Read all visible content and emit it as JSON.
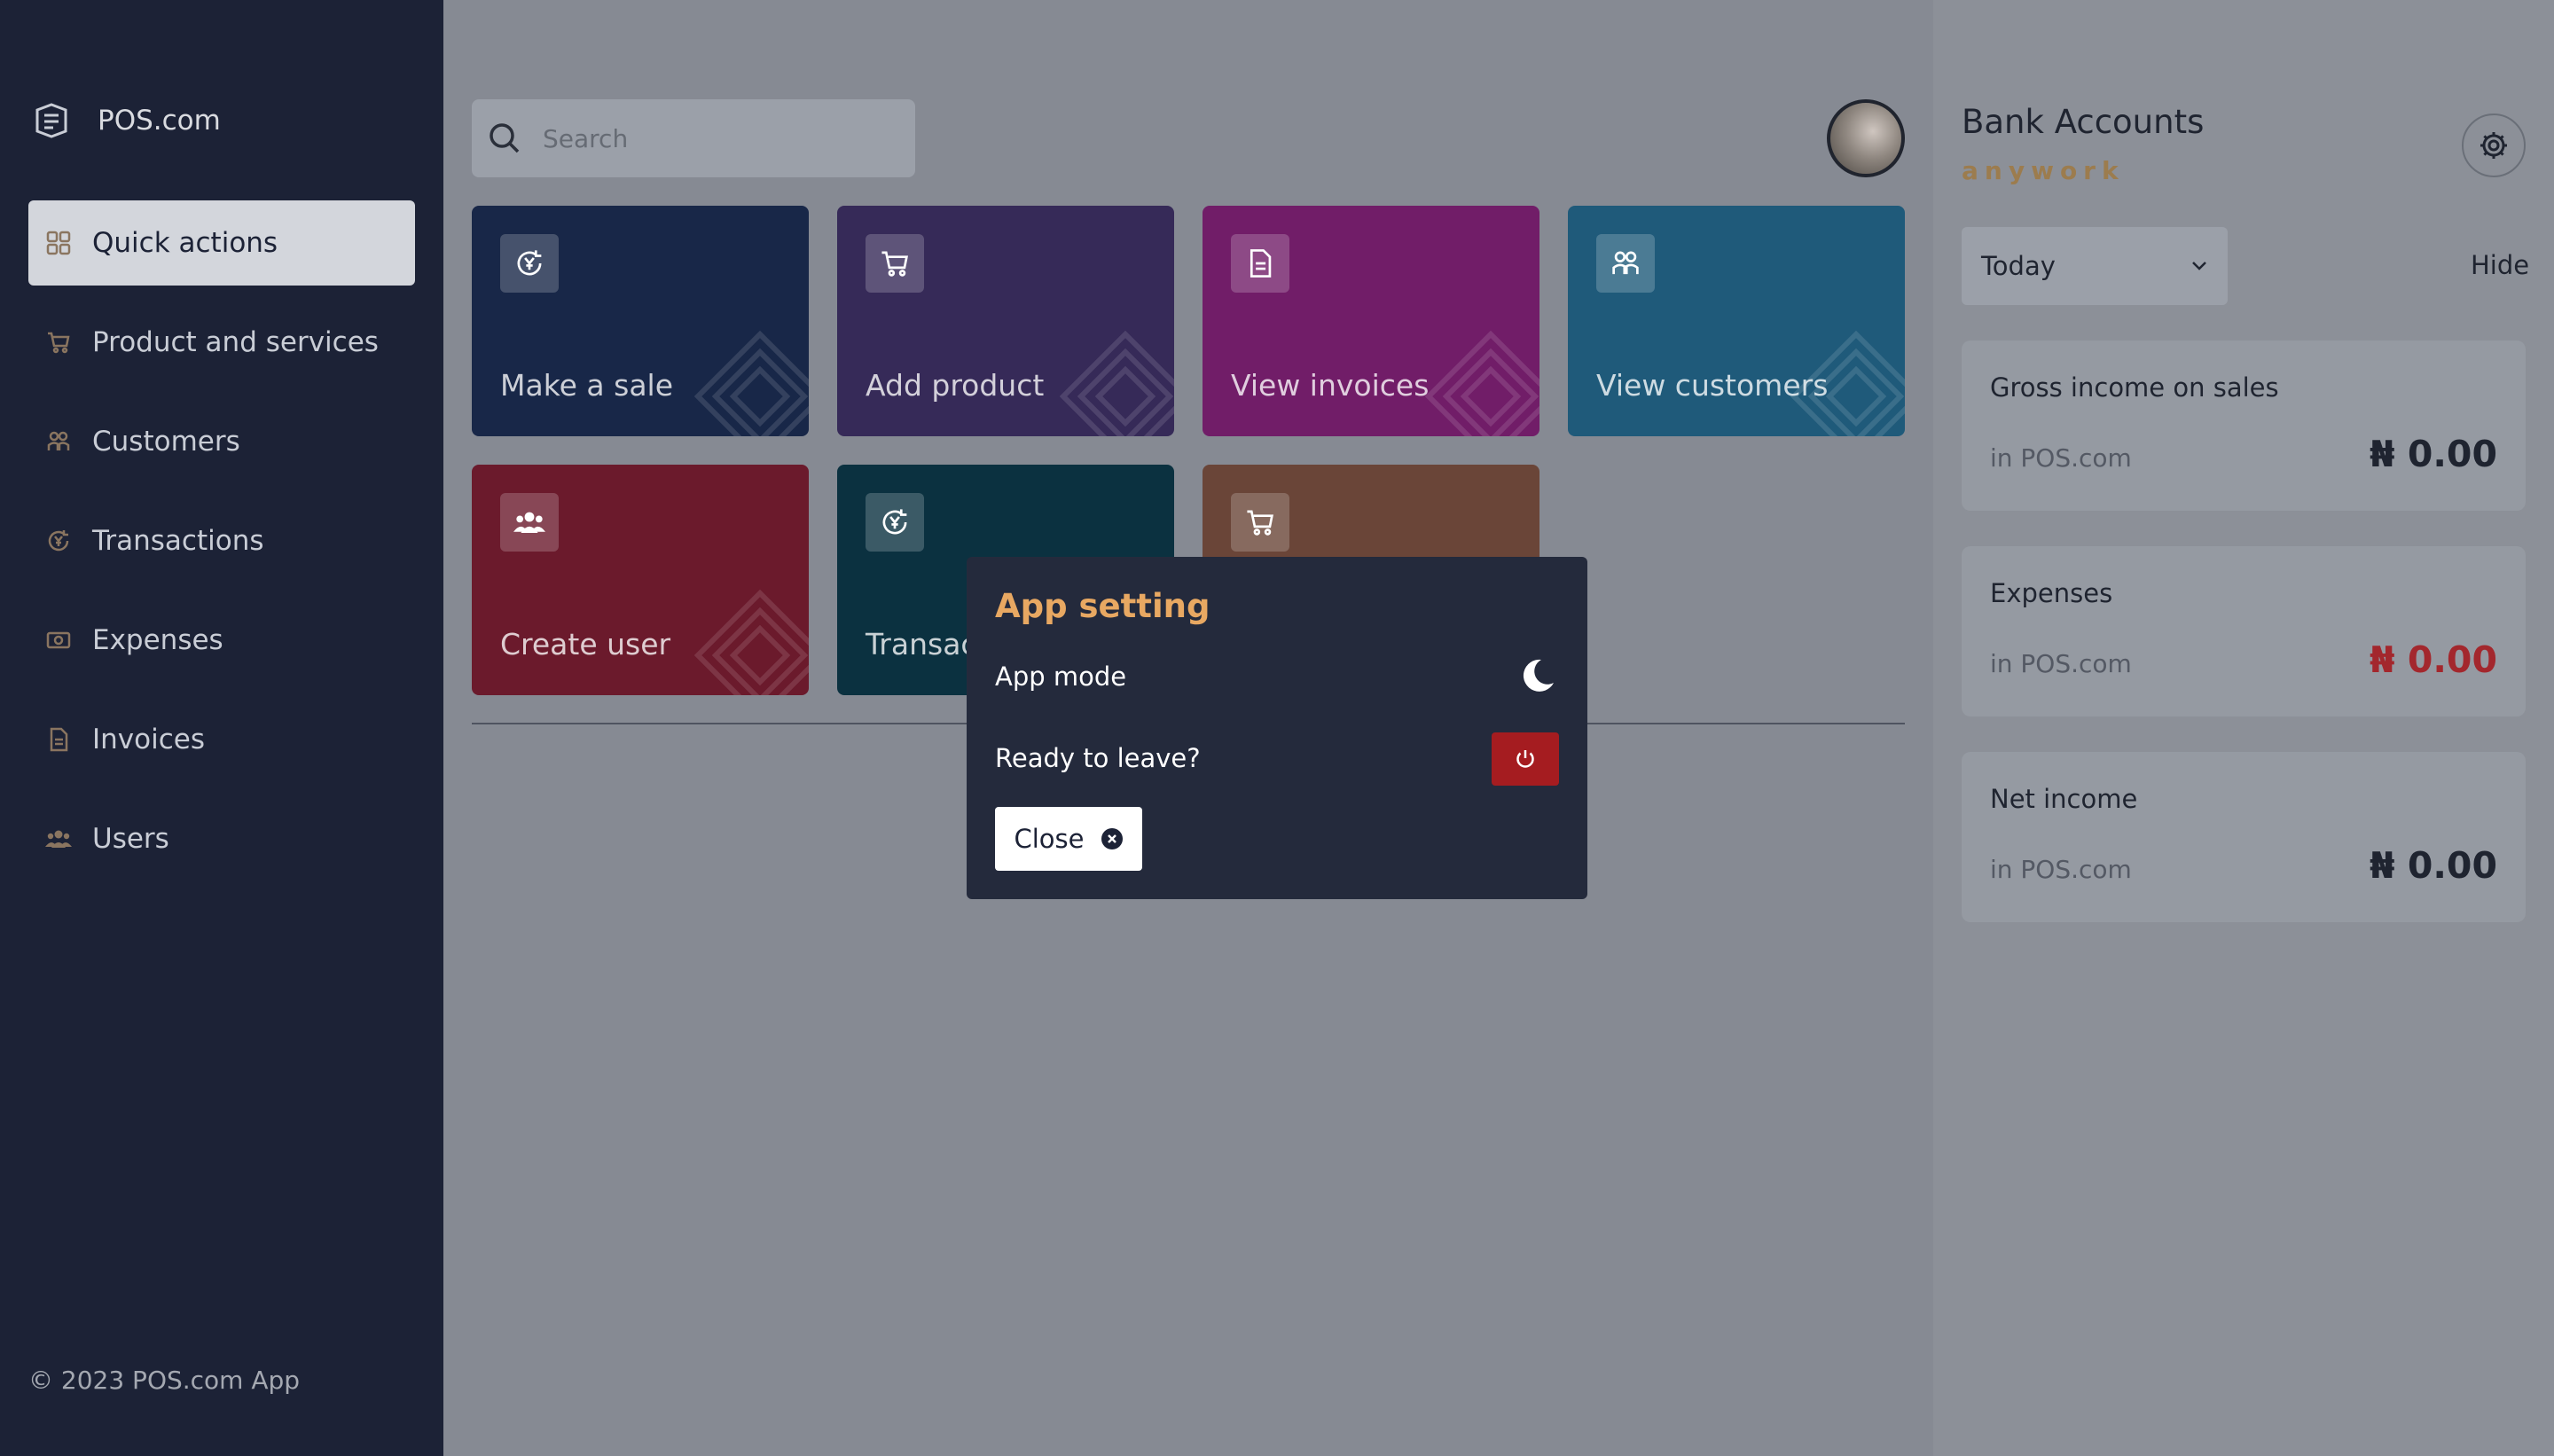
{
  "sidebar": {
    "brand": "POS.com",
    "items": [
      {
        "label": "Quick actions",
        "icon": "grid-icon"
      },
      {
        "label": "Product and services",
        "icon": "cart-icon"
      },
      {
        "label": "Customers",
        "icon": "customers-icon"
      },
      {
        "label": "Transactions",
        "icon": "transaction-icon"
      },
      {
        "label": "Expenses",
        "icon": "money-icon"
      },
      {
        "label": "Invoices",
        "icon": "invoice-icon"
      },
      {
        "label": "Users",
        "icon": "users-icon"
      }
    ],
    "footer": "© 2023 POS.com App"
  },
  "search": {
    "placeholder": "Search",
    "value": ""
  },
  "tiles": [
    {
      "label": "Make a sale",
      "icon": "transaction-icon",
      "color": "#182748"
    },
    {
      "label": "Add product",
      "icon": "cart-icon",
      "color": "#362a58"
    },
    {
      "label": "View invoices",
      "icon": "invoice-icon",
      "color": "#711d68"
    },
    {
      "label": "View customers",
      "icon": "customers-icon",
      "color": "#1f5a7a"
    },
    {
      "label": "Create user",
      "icon": "users-icon",
      "color": "#6b1a2c"
    },
    {
      "label": "Transac",
      "icon": "transaction-icon",
      "color": "#0b3140"
    },
    {
      "label": "",
      "icon": "cart-icon",
      "color": "#6a4538"
    }
  ],
  "right_panel": {
    "title": "Bank Accounts",
    "subtitle": "anywork",
    "period": "Today",
    "hide_label": "Hide",
    "cards": [
      {
        "title": "Gross income on sales",
        "sub": "in POS.com",
        "value": "₦ 0.00"
      },
      {
        "title": "Expenses",
        "sub": "in POS.com",
        "value": "₦ 0.00"
      },
      {
        "title": "Net income",
        "sub": "in POS.com",
        "value": "₦ 0.00"
      }
    ]
  },
  "modal": {
    "title": "App setting",
    "app_mode_label": "App mode",
    "leave_label": "Ready to leave?",
    "close_label": "Close"
  },
  "colors": {
    "sidebar_bg": "#1c2236",
    "accent": "#e8a862",
    "danger": "#a51c20",
    "expense_value": "#a3272d"
  }
}
